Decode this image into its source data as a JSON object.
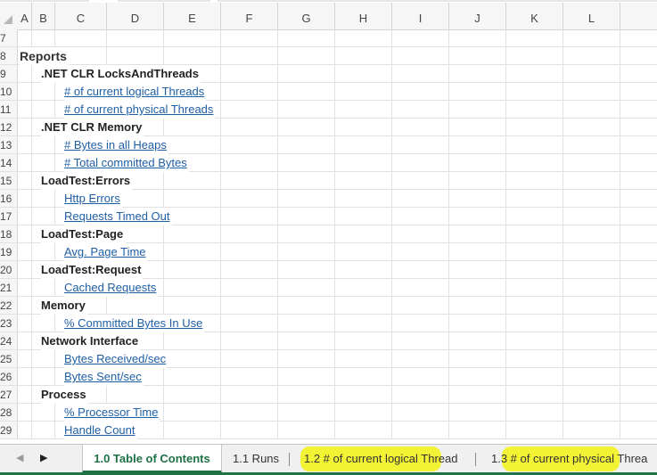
{
  "columns": [
    "A",
    "B",
    "C",
    "D",
    "E",
    "F",
    "G",
    "H",
    "I",
    "J",
    "K",
    "L"
  ],
  "rows": [
    {
      "num": "7"
    },
    {
      "num": "8",
      "report": "Reports"
    },
    {
      "num": "9",
      "group": ".NET CLR LocksAndThreads"
    },
    {
      "num": "10",
      "link": "# of current logical Threads"
    },
    {
      "num": "11",
      "link": "# of current physical Threads"
    },
    {
      "num": "12",
      "group": ".NET CLR Memory"
    },
    {
      "num": "13",
      "link": "# Bytes in all Heaps"
    },
    {
      "num": "14",
      "link": "# Total committed Bytes"
    },
    {
      "num": "15",
      "group": "LoadTest:Errors"
    },
    {
      "num": "16",
      "link": "Http Errors"
    },
    {
      "num": "17",
      "link": "Requests Timed Out"
    },
    {
      "num": "18",
      "group": "LoadTest:Page"
    },
    {
      "num": "19",
      "link": "Avg. Page Time"
    },
    {
      "num": "20",
      "group": "LoadTest:Request"
    },
    {
      "num": "21",
      "link": "Cached Requests"
    },
    {
      "num": "22",
      "group": "Memory"
    },
    {
      "num": "23",
      "link": "% Committed Bytes In Use"
    },
    {
      "num": "24",
      "group": "Network Interface"
    },
    {
      "num": "25",
      "link": "Bytes Received/sec"
    },
    {
      "num": "26",
      "link": "Bytes Sent/sec"
    },
    {
      "num": "27",
      "group": "Process"
    },
    {
      "num": "28",
      "link": "% Processor Time"
    },
    {
      "num": "29",
      "link": "Handle Count"
    }
  ],
  "tabs": {
    "toc": "1.0 Table of Contents",
    "runs": "1.1 Runs",
    "logical": "1.2 # of current logical Thread",
    "physical": "1.3 # of current physical Threa"
  },
  "nav": {
    "prev": "◀",
    "next": "▶"
  },
  "colors": {
    "accent": "#1e7145",
    "link": "#1f5fa6",
    "highlight": "#f2f22a"
  }
}
